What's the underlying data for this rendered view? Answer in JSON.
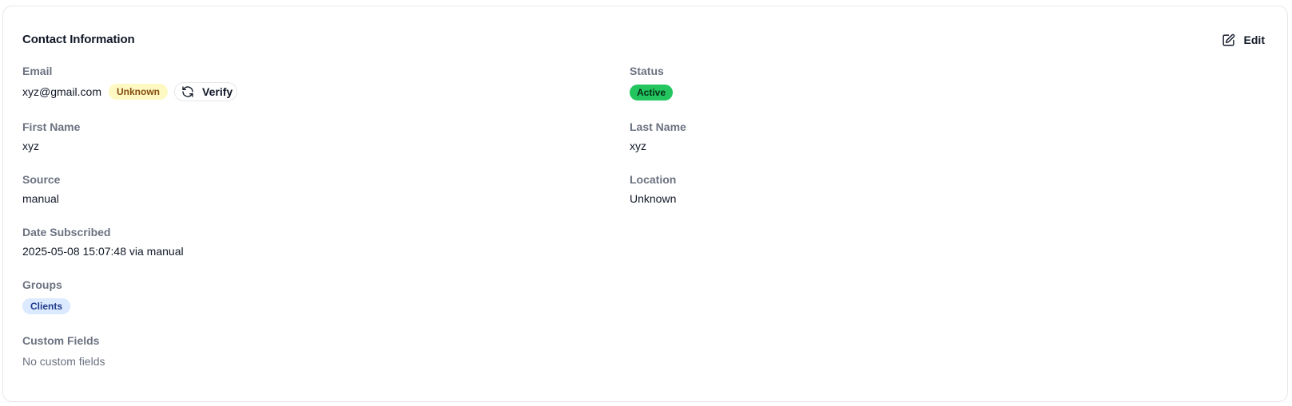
{
  "card": {
    "title": "Contact Information",
    "edit_label": "Edit"
  },
  "email": {
    "label": "Email",
    "value": "xyz@gmail.com",
    "verification_badge": "Unknown",
    "verify_label": "Verify"
  },
  "status": {
    "label": "Status",
    "value": "Active"
  },
  "first_name": {
    "label": "First Name",
    "value": "xyz"
  },
  "last_name": {
    "label": "Last Name",
    "value": "xyz"
  },
  "source": {
    "label": "Source",
    "value": "manual"
  },
  "location": {
    "label": "Location",
    "value": "Unknown"
  },
  "date_subscribed": {
    "label": "Date Subscribed",
    "value": "2025-05-08 15:07:48 via manual"
  },
  "groups": {
    "label": "Groups",
    "items": [
      "Clients"
    ]
  },
  "custom_fields": {
    "label": "Custom Fields",
    "empty_text": "No custom fields"
  },
  "icons": {
    "edit": "edit-icon",
    "verify": "refresh-icon"
  },
  "colors": {
    "active_badge_bg": "#22c55e",
    "unknown_badge_bg": "#fef9c3",
    "group_badge_bg": "#dbeafe",
    "label_text": "#6b7280"
  }
}
